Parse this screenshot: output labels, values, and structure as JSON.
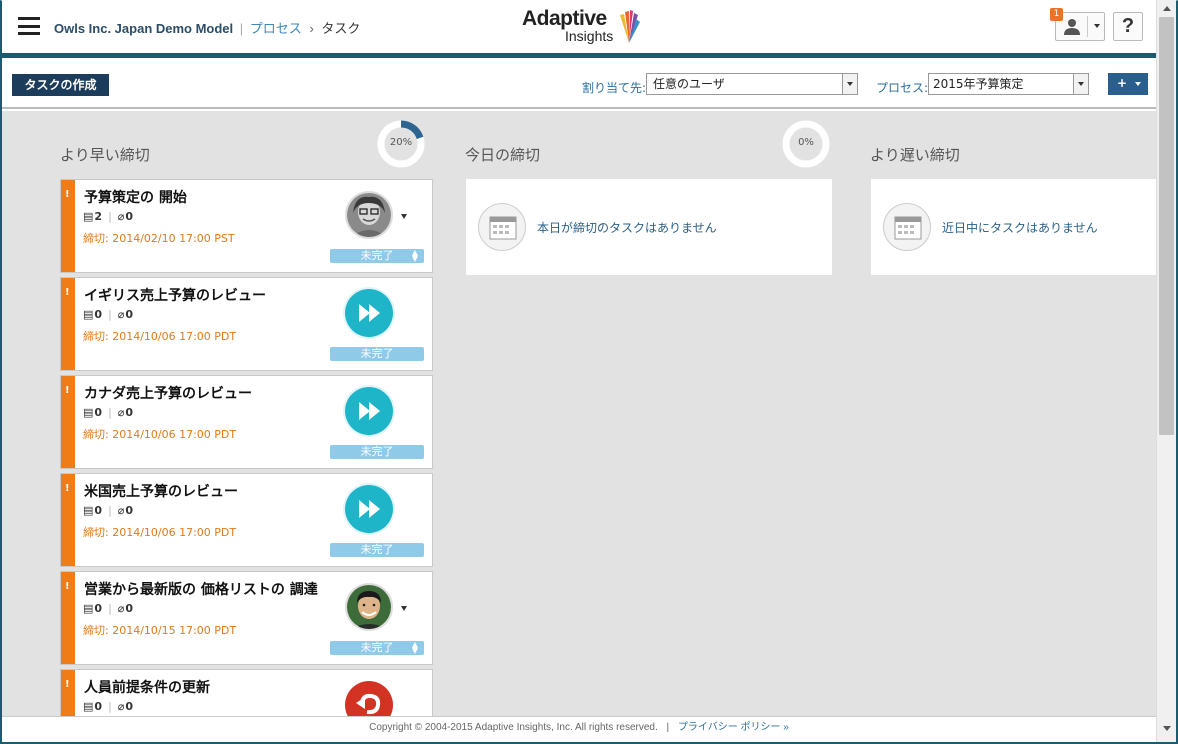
{
  "header": {
    "model_name": "Owls Inc. Japan Demo Model",
    "separator": "|",
    "breadcrumb_link": "プロセス",
    "breadcrumb_arrow": "›",
    "breadcrumb_current": "タスク",
    "logo_word1": "Adaptive",
    "logo_word2": "Insights",
    "notification_count": "1",
    "help_label": "?"
  },
  "toolbar": {
    "create_task_label": "タスクの作成",
    "assign_label": "割り当て先:",
    "assign_value": "任意のユーザ",
    "process_label": "プロセス:",
    "process_value": "2015年予算策定",
    "add_label": "+"
  },
  "columns": [
    {
      "title": "より早い締切",
      "gauge_percent": 20,
      "gauge_label": "20%"
    },
    {
      "title": "今日の締切",
      "gauge_percent": 0,
      "gauge_label": "0%",
      "empty_text": "本日が締切のタスクはありません"
    },
    {
      "title": "より遅い締切",
      "empty_text": "近日中にタスクはありません"
    }
  ],
  "tasks": [
    {
      "title": "予算策定の 開始",
      "notes": "2",
      "attachments": "0",
      "due": "締切: 2014/02/10 17:00 PST",
      "status": "未完了",
      "action": "avatar-woman"
    },
    {
      "title": "イギリス売上予算のレビュー",
      "notes": "0",
      "attachments": "0",
      "due": "締切: 2014/10/06 17:00 PDT",
      "status": "未完了",
      "action": "play"
    },
    {
      "title": "カナダ売上予算のレビュー",
      "notes": "0",
      "attachments": "0",
      "due": "締切: 2014/10/06 17:00 PDT",
      "status": "未完了",
      "action": "play"
    },
    {
      "title": "米国売上予算のレビュー",
      "notes": "0",
      "attachments": "0",
      "due": "締切: 2014/10/06 17:00 PDT",
      "status": "未完了",
      "action": "play"
    },
    {
      "title": "営業から最新版の 価格リストの 調達",
      "notes": "0",
      "attachments": "0",
      "due": "締切: 2014/10/15 17:00 PDT",
      "status": "未完了",
      "action": "avatar-man"
    },
    {
      "title": "人員前提条件の更新",
      "notes": "0",
      "attachments": "0",
      "due": "",
      "status": "",
      "action": "undo"
    }
  ],
  "footer": {
    "copyright": "Copyright © 2004-2015 Adaptive Insights, Inc. All rights reserved.",
    "separator": "|",
    "privacy": "プライバシー ポリシー »"
  },
  "colors": {
    "accent_dark": "#1b3c5a",
    "header_bar": "#1d5a70",
    "flag_orange": "#f07c18",
    "play_teal": "#1eb5c8",
    "undo_red": "#d33323",
    "status_blue": "#8fcbe8"
  }
}
